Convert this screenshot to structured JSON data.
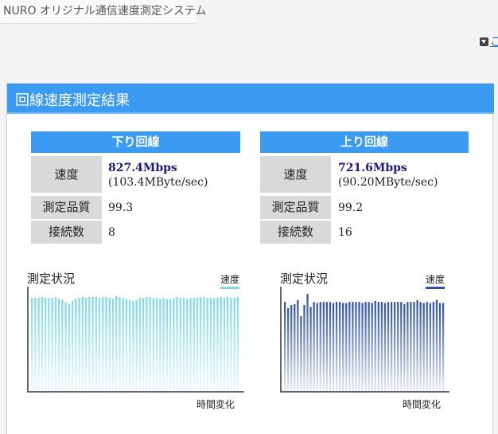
{
  "header": {
    "title": "NURO オリジナル通信速度測定システム",
    "menu_link": "こ"
  },
  "panel": {
    "title": "回線速度測定結果"
  },
  "download": {
    "heading": "下り回線",
    "speed_label": "速度",
    "speed_value": "827.4Mbps",
    "speed_sub": "(103.4MByte/sec)",
    "quality_label": "測定品質",
    "quality_value": "99.3",
    "connections_label": "接続数",
    "connections_value": "8"
  },
  "upload": {
    "heading": "上り回線",
    "speed_label": "速度",
    "speed_value": "721.6Mbps",
    "speed_sub": "(90.20MByte/sec)",
    "quality_label": "測定品質",
    "quality_value": "99.2",
    "connections_label": "接続数",
    "connections_value": "16"
  },
  "chart_data": [
    {
      "type": "bar",
      "title": "測定状況",
      "xlabel": "時間変化",
      "ylabel": "",
      "legend": "速度",
      "legend_position": "top-right",
      "color": "#7fd8e3",
      "values": [
        92,
        92,
        92,
        93,
        92,
        92,
        92,
        93,
        91,
        90,
        88,
        86,
        89,
        91,
        92,
        93,
        92,
        93,
        93,
        93,
        92,
        93,
        93,
        92,
        91,
        94,
        93,
        92,
        91,
        90,
        89,
        90,
        92,
        92,
        93,
        93,
        92,
        92,
        91,
        92,
        91,
        91,
        92,
        93,
        92,
        92,
        91,
        92,
        92,
        92,
        93,
        93,
        92,
        92,
        92,
        92,
        93,
        92,
        93,
        92,
        92,
        93
      ]
    },
    {
      "type": "bar",
      "title": "測定状況",
      "xlabel": "時間変化",
      "ylabel": "",
      "legend": "速度",
      "legend_position": "top-right",
      "color": "#2b4fa8",
      "values": [
        88,
        82,
        85,
        86,
        90,
        74,
        85,
        96,
        83,
        88,
        87,
        88,
        88,
        88,
        88,
        87,
        88,
        88,
        87,
        87,
        88,
        88,
        88,
        88,
        87,
        88,
        88,
        87,
        89,
        88,
        88,
        87,
        88,
        88,
        88,
        88,
        88,
        86,
        88,
        88,
        88,
        90,
        88,
        87,
        88,
        87,
        88,
        90,
        87,
        87
      ]
    }
  ]
}
